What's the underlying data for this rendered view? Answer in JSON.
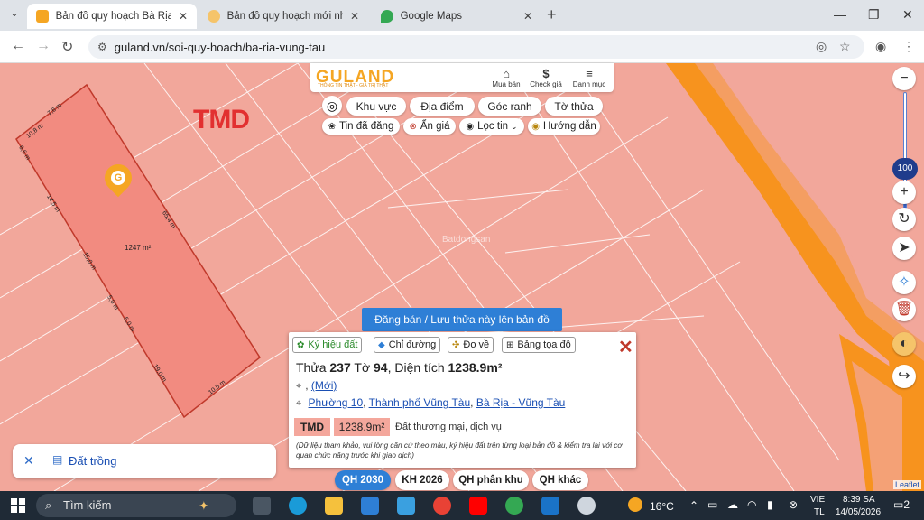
{
  "browser": {
    "tabs": [
      {
        "title": "Bản đồ quy hoạch Bà Rịa - Vũng",
        "active": true
      },
      {
        "title": "Bản đồ quy hoạch mới nhất Thà",
        "active": false
      },
      {
        "title": "Google Maps",
        "active": false
      }
    ],
    "url": "guland.vn/soi-quy-hoach/ba-ria-vung-tau"
  },
  "header": {
    "logo": "GULAND",
    "logo_sub": "THÔNG TIN THẬT - GIÁ TRỊ THẬT",
    "items": [
      "Mua bán",
      "Check giá",
      "Danh mục"
    ]
  },
  "filters": {
    "row1": [
      "Khu vực",
      "Địa điểm",
      "Góc ranh",
      "Tờ thửa"
    ],
    "row2": [
      "Tin đã đăng",
      "Ẩn giá",
      "Lọc tin",
      "Hướng dẫn"
    ]
  },
  "map": {
    "zone_label": "TMD",
    "parcel_area": "1247 m²",
    "edge_labels": [
      "7,6 m",
      "10,8 m",
      "6,6 m",
      "14,5 m",
      "15,0 m",
      "5,0 m",
      "5,0 m",
      "19,0 m",
      "65,4 m",
      "10,5 m"
    ],
    "zoom_level": "100",
    "watermark": "Batdongsan"
  },
  "post_banner": "Đăng bán / Lưu thửa này lên bản đồ",
  "popup": {
    "tabs": [
      "Ký hiệu đất",
      "Chỉ đường",
      "Đo về",
      "Bảng tọa độ"
    ],
    "title_prefix": "Thửa",
    "plot_no": "237",
    "sheet_prefix": "Tờ",
    "sheet_no": "94",
    "area_prefix": ", Diện tích",
    "area": "1238.9m²",
    "address_line1_pre": ",",
    "address_line1_link": "(Mới)",
    "ward": "Phường 10",
    "city": "Thành phố Vũng Tàu",
    "province": "Bà Rịa - Vũng Tàu",
    "zone_code": "TMD",
    "zone_area": "1238.9m²",
    "zone_desc": "Đất thương mại, dịch vụ",
    "disclaimer": "(Dữ liệu tham khảo, vui lòng căn cứ theo màu, ký hiệu đất trên từng loại bản đồ & kiểm tra lại với cơ quan chức năng trước khi giao dịch)"
  },
  "empty_land": "Đất trồng",
  "plan_tabs": [
    "QH 2030",
    "KH 2026",
    "QH phân khu",
    "QH khác"
  ],
  "leaflet": "Leaflet",
  "taskbar": {
    "search": "Tìm kiếm",
    "weather": "16°C",
    "lang1": "VIE",
    "lang2": "TL",
    "time": "8:39 SA",
    "date": "14/05/2026",
    "notif": "2"
  }
}
